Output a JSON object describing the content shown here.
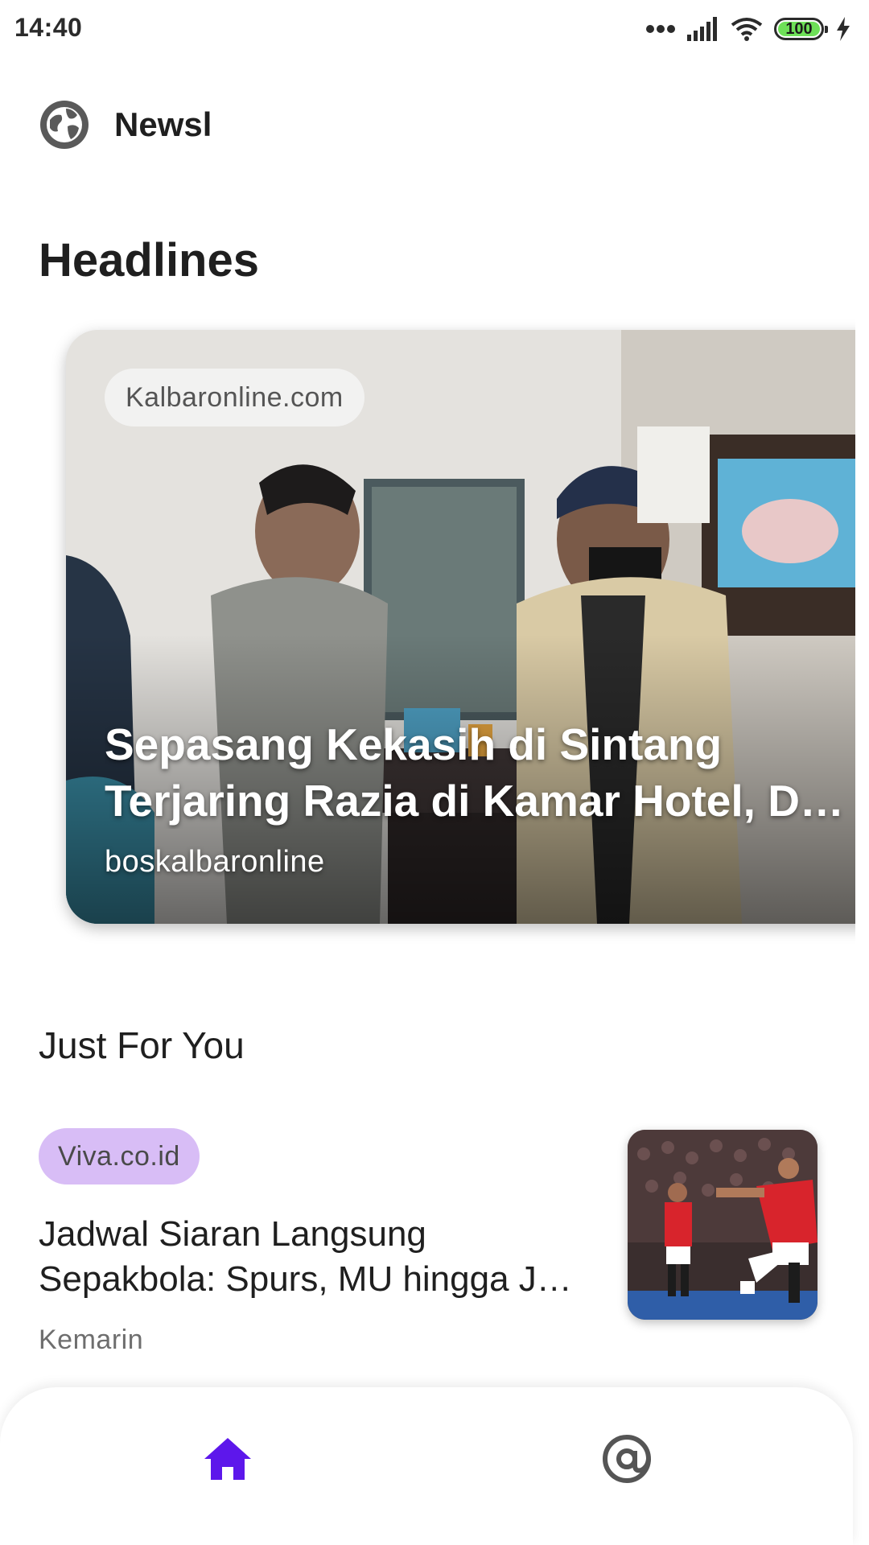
{
  "status_bar": {
    "time": "14:40",
    "battery": "100"
  },
  "app_bar": {
    "title": "Newsl",
    "icon": "globe-icon"
  },
  "headlines": {
    "section_title": "Headlines",
    "items": [
      {
        "chip": "Kalbaronline.com",
        "title": "Sepasang Kekasih di Sintang Terjaring Razia di Kamar Hotel, D…",
        "source": "boskalbaronline"
      }
    ]
  },
  "just_for_you": {
    "section_title": "Just For You",
    "items": [
      {
        "chip": "Viva.co.id",
        "title": "Jadwal Siaran Langsung Sepakbola: Spurs, MU hingga J…",
        "time": "Kemarin"
      }
    ]
  },
  "bottom_nav": {
    "items": [
      {
        "icon": "home-icon",
        "active": true
      },
      {
        "icon": "at-sign-icon",
        "active": false
      }
    ]
  },
  "colors": {
    "accent": "#5d17eb",
    "chip_purple": "#d8bdf6",
    "battery_green": "#6ee058",
    "inactive_icon": "#555555"
  }
}
